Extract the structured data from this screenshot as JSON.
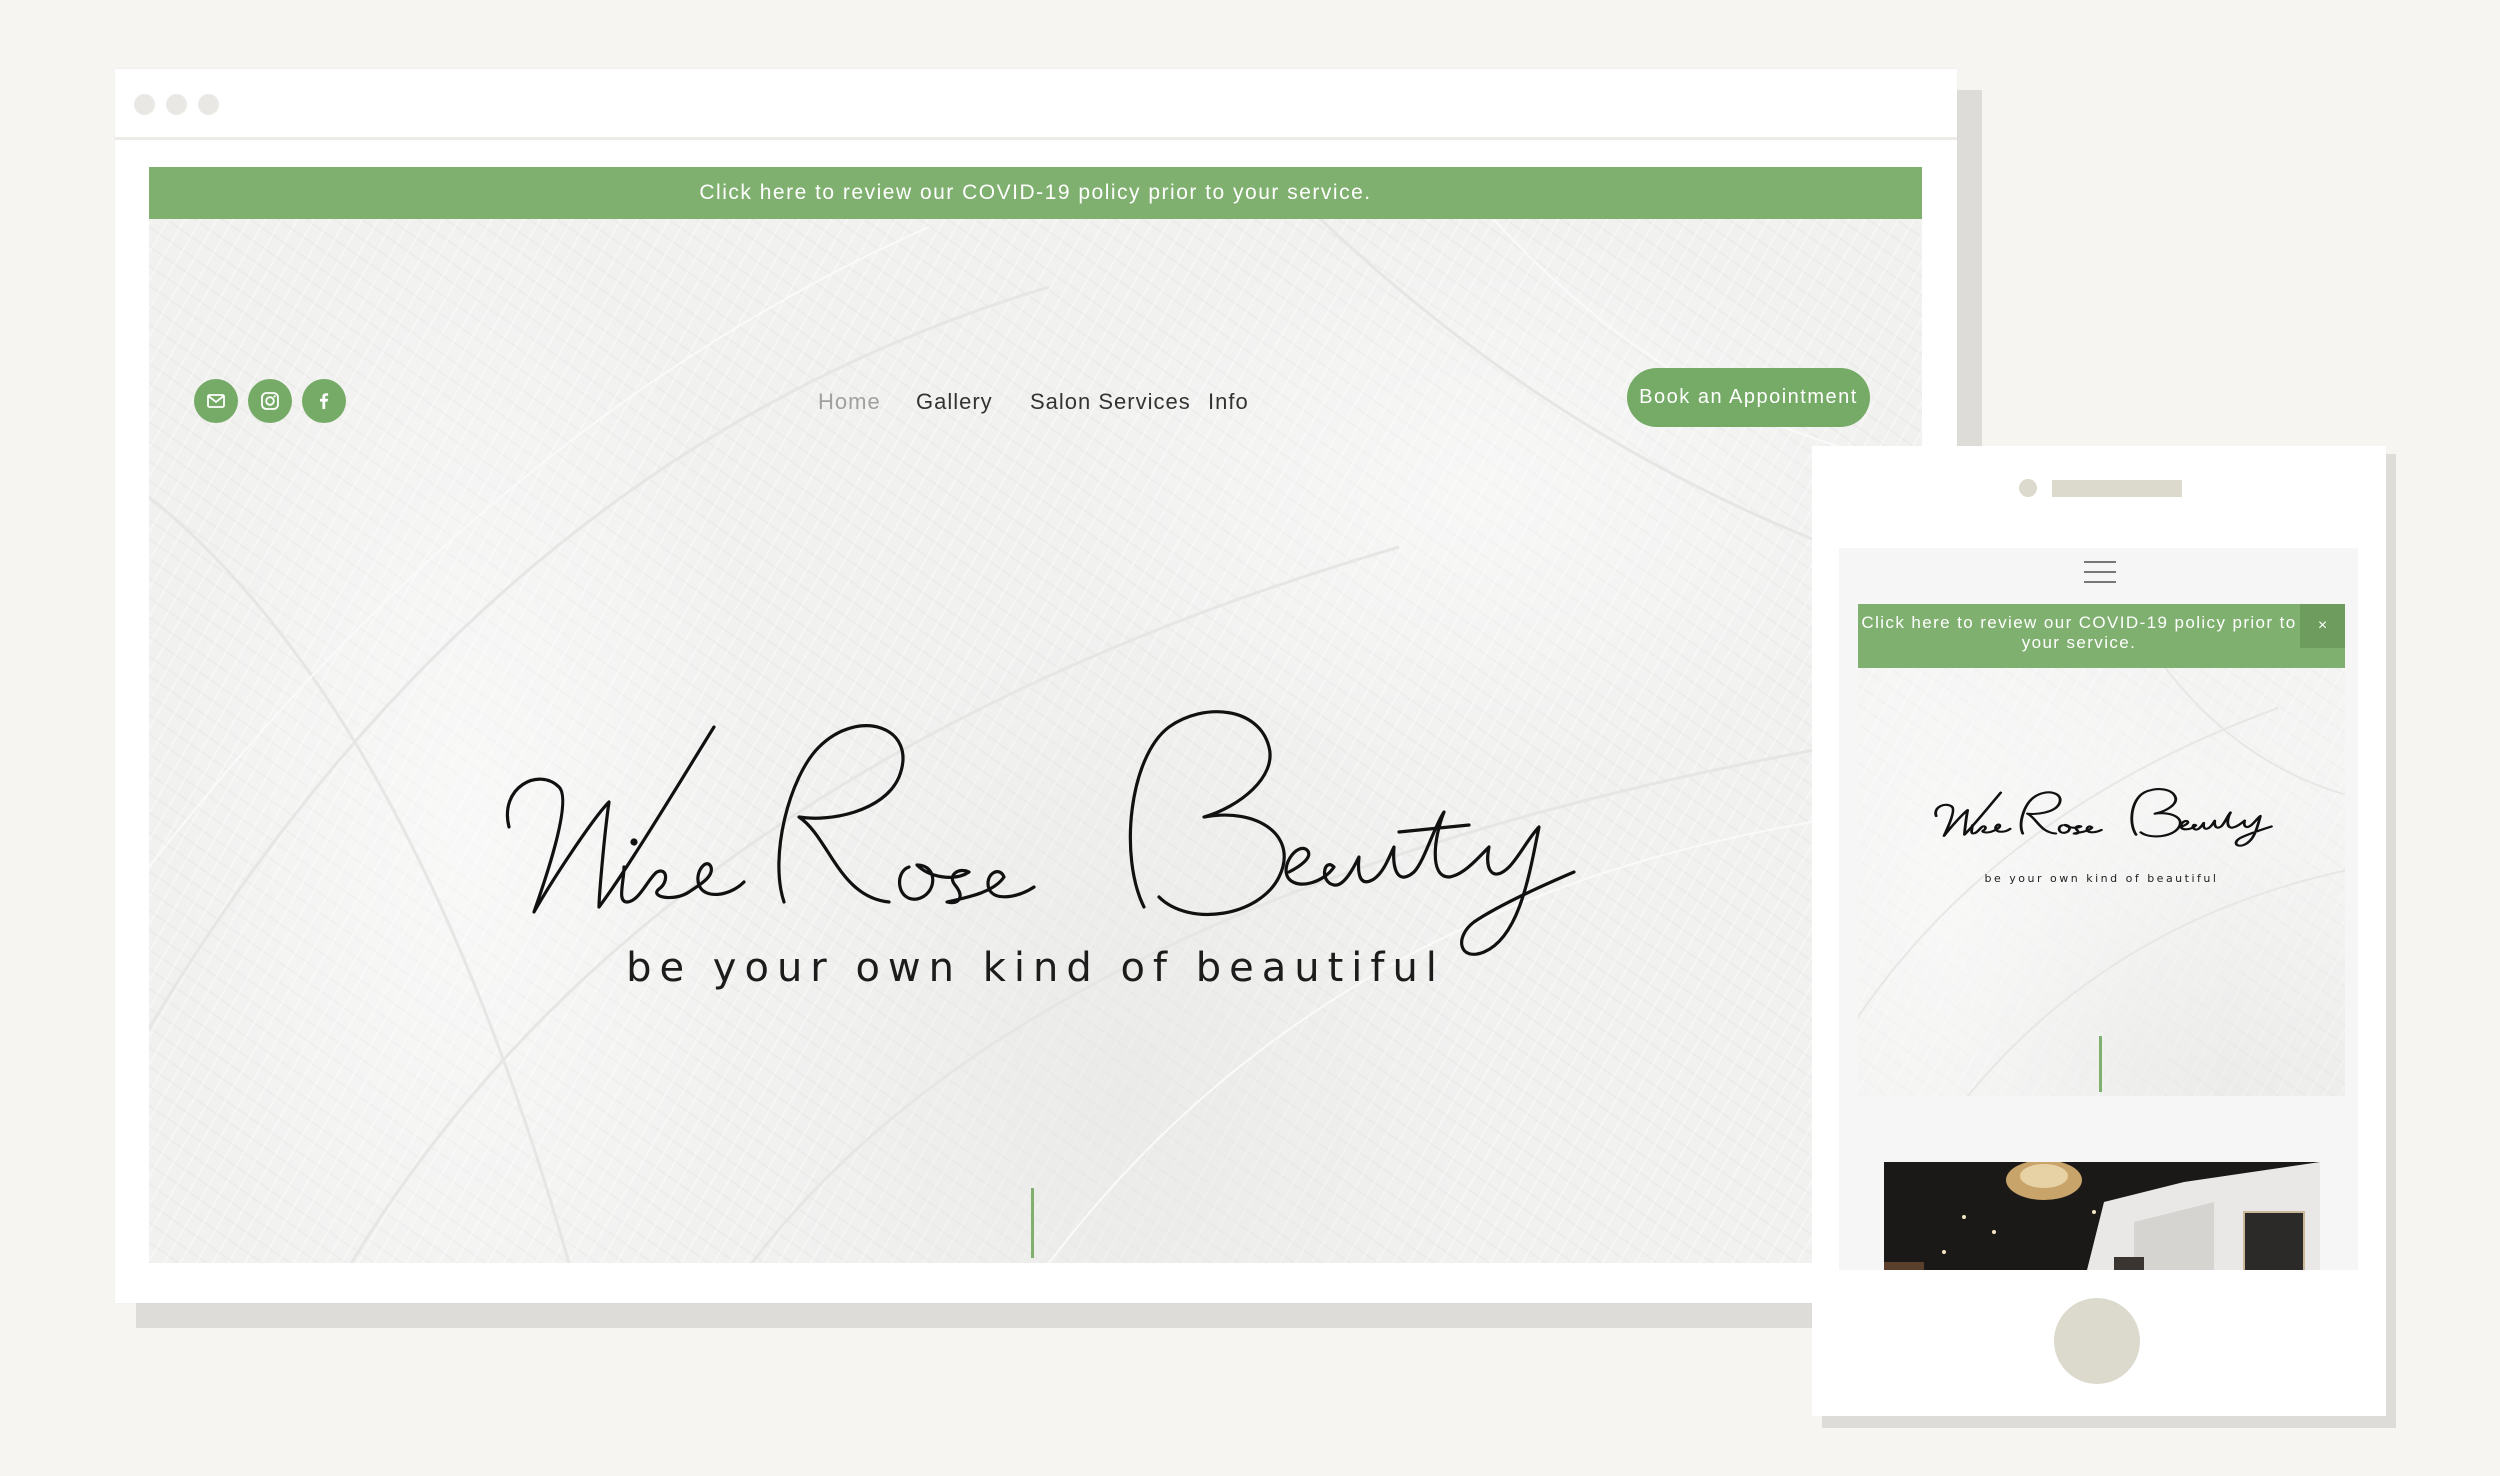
{
  "desktop": {
    "covid_banner": "Click here to review our COVID-19 policy prior to your service.",
    "social_icons": [
      "mail-icon",
      "instagram-icon",
      "facebook-icon"
    ],
    "nav": {
      "home": "Home",
      "gallery": "Gallery",
      "salon_services": "Salon Services",
      "info": "Info"
    },
    "book_button": "Book an Appointment",
    "hero": {
      "title": "Wise Rose Beauty",
      "subtitle": "be your own kind of beautiful"
    }
  },
  "mobile": {
    "menu_icon": "hamburger-menu-icon",
    "covid_banner": "Click here to review our COVID-19 policy prior to your service.",
    "close_label": "×",
    "hero": {
      "title": "Wise Rose Beauty",
      "subtitle": "be your own kind of beautiful"
    }
  },
  "colors": {
    "accent_green": "#7fb06f",
    "button_green": "#76ab67",
    "background": "#f6f5f2",
    "device_accent": "#dcd9cd"
  }
}
